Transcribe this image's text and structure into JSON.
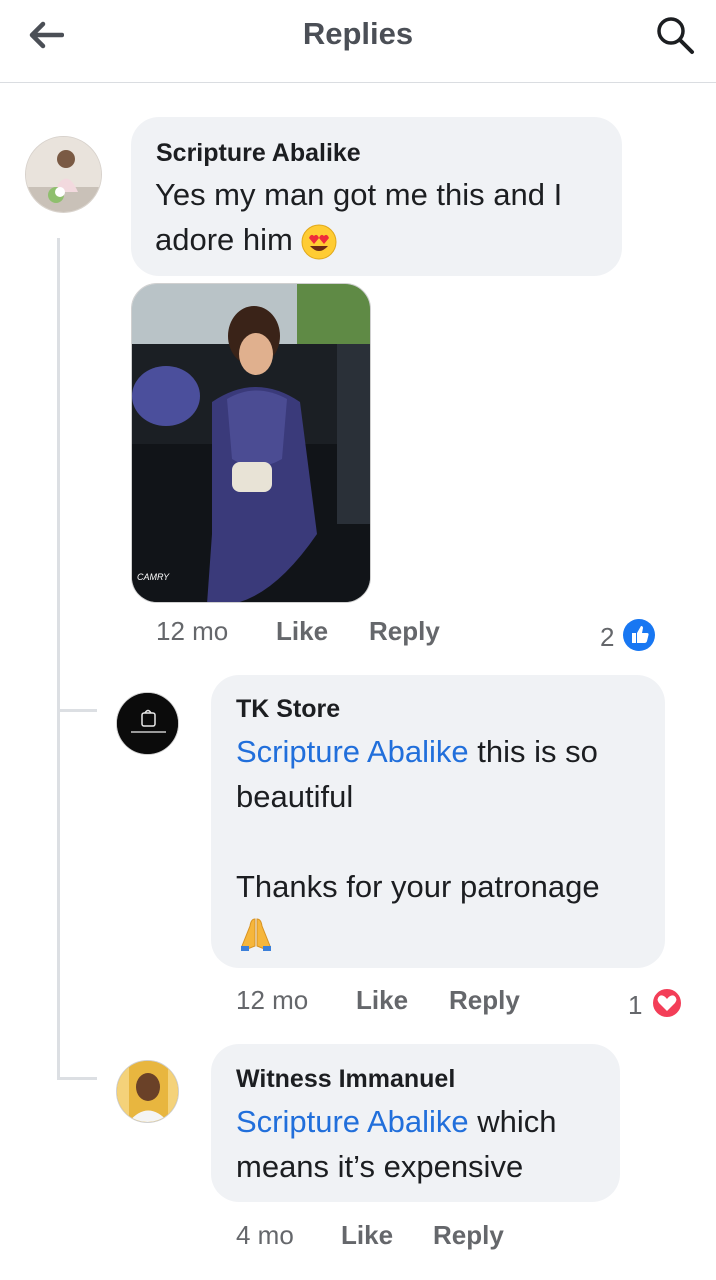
{
  "header": {
    "title": "Replies",
    "back_icon": "back-arrow-icon",
    "search_icon": "search-icon"
  },
  "comments": [
    {
      "author": "Scripture Abalike",
      "text": "Yes my man got me this and I adore him",
      "emoji": "heart-eyes-emoji",
      "has_photo": true,
      "time": "12 mo",
      "like_label": "Like",
      "reply_label": "Reply",
      "reaction_count": "2",
      "reaction_icon": "like-reaction-icon"
    },
    {
      "author": "TK Store",
      "mention": "Scripture Abalike",
      "text_line1": " this is so beautiful",
      "text_line2": "Thanks for your patronage",
      "emoji": "folded-hands-emoji",
      "time": "12 mo",
      "like_label": "Like",
      "reply_label": "Reply",
      "reaction_count": "1",
      "reaction_icon": "love-reaction-icon"
    },
    {
      "author": "Witness Immanuel",
      "mention": "Scripture Abalike",
      "text": " which means it’s expensive",
      "time": "4 mo",
      "like_label": "Like",
      "reply_label": "Reply"
    }
  ],
  "colors": {
    "mention": "#216fdb",
    "bubble": "#f0f2f5",
    "like_blue": "#1877f2",
    "love_red": "#f33e58",
    "meta_gray": "#65676b"
  }
}
